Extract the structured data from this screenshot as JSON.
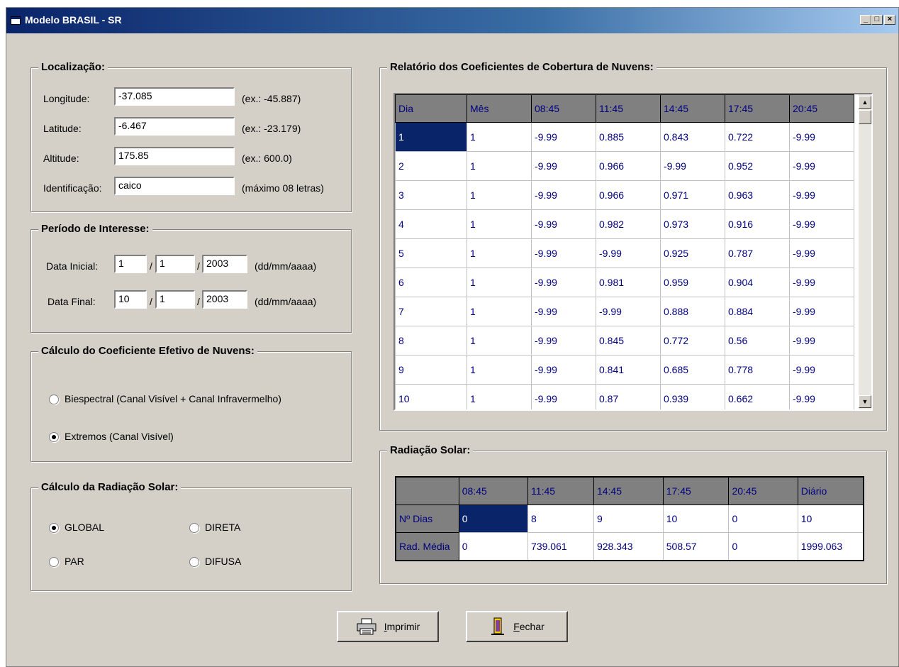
{
  "window": {
    "title": "Modelo BRASIL - SR",
    "min": "_",
    "max": "□",
    "close": "×"
  },
  "localizacao": {
    "title": "Localização:",
    "rows": [
      {
        "label": "Longitude:",
        "value": "-37.085",
        "hint": "(ex.: -45.887)"
      },
      {
        "label": "Latitude:",
        "value": "-6.467",
        "hint": "(ex.: -23.179)"
      },
      {
        "label": "Altitude:",
        "value": "175.85",
        "hint": "(ex.: 600.0)"
      },
      {
        "label": "Identificação:",
        "value": "caico",
        "hint": "(máximo 08 letras)"
      }
    ]
  },
  "periodo": {
    "title": "Período de Interesse:",
    "inicial": {
      "label": "Data Inicial:",
      "day": "1",
      "month": "1",
      "year": "2003",
      "fmt": "(dd/mm/aaaa)"
    },
    "final": {
      "label": "Data Final:",
      "day": "10",
      "month": "1",
      "year": "2003",
      "fmt": "(dd/mm/aaaa)"
    },
    "sep": "/"
  },
  "coeficiente": {
    "title": "Cálculo do Coeficiente Efetivo de Nuvens:",
    "options": [
      {
        "label": "Biespectral (Canal Visível + Canal Infravermelho)",
        "checked": false
      },
      {
        "label": "Extremos (Canal Visível)",
        "checked": true
      }
    ]
  },
  "radiacao_calc": {
    "title": "Cálculo da Radiação Solar:",
    "options": [
      {
        "label": "GLOBAL",
        "checked": true
      },
      {
        "label": "DIRETA",
        "checked": false
      },
      {
        "label": "PAR",
        "checked": false
      },
      {
        "label": "DIFUSA",
        "checked": false
      }
    ]
  },
  "relatorio": {
    "title": "Relatório dos Coeficientes de Cobertura de Nuvens:",
    "headers": [
      "Dia",
      "Mês",
      "08:45",
      "11:45",
      "14:45",
      "17:45",
      "20:45"
    ],
    "rows": [
      [
        "1",
        "1",
        "-9.99",
        "0.885",
        "0.843",
        "0.722",
        "-9.99"
      ],
      [
        "2",
        "1",
        "-9.99",
        "0.966",
        "-9.99",
        "0.952",
        "-9.99"
      ],
      [
        "3",
        "1",
        "-9.99",
        "0.966",
        "0.971",
        "0.963",
        "-9.99"
      ],
      [
        "4",
        "1",
        "-9.99",
        "0.982",
        "0.973",
        "0.916",
        "-9.99"
      ],
      [
        "5",
        "1",
        "-9.99",
        "-9.99",
        "0.925",
        "0.787",
        "-9.99"
      ],
      [
        "6",
        "1",
        "-9.99",
        "0.981",
        "0.959",
        "0.904",
        "-9.99"
      ],
      [
        "7",
        "1",
        "-9.99",
        "-9.99",
        "0.888",
        "0.884",
        "-9.99"
      ],
      [
        "8",
        "1",
        "-9.99",
        "0.845",
        "0.772",
        "0.56",
        "-9.99"
      ],
      [
        "9",
        "1",
        "-9.99",
        "0.841",
        "0.685",
        "0.778",
        "-9.99"
      ],
      [
        "10",
        "1",
        "-9.99",
        "0.87",
        "0.939",
        "0.662",
        "-9.99"
      ]
    ]
  },
  "radiacao": {
    "title": "Radiação Solar:",
    "headers": [
      "",
      "08:45",
      "11:45",
      "14:45",
      "17:45",
      "20:45",
      "Diário"
    ],
    "rows": [
      [
        "Nº Dias",
        "0",
        "8",
        "9",
        "10",
        "0",
        "10"
      ],
      [
        "Rad. Média",
        "0",
        "739.061",
        "928.343",
        "508.57",
        "0",
        "1999.063"
      ]
    ]
  },
  "buttons": {
    "print": {
      "accel": "I",
      "rest": "mprimir"
    },
    "close": {
      "accel": "F",
      "rest": "echar"
    }
  }
}
